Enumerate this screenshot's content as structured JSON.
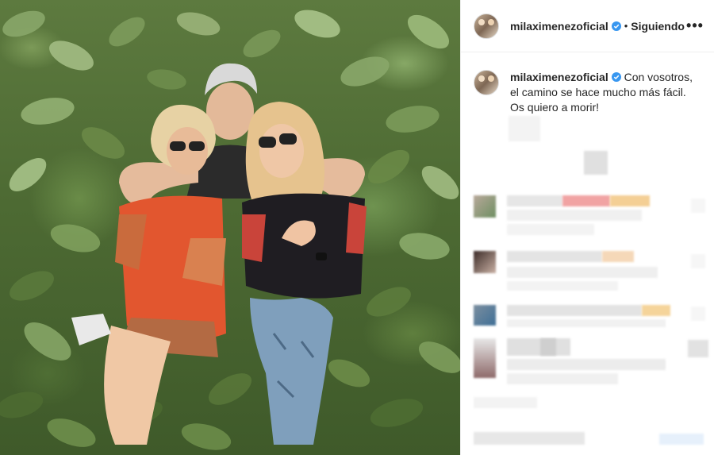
{
  "post": {
    "username": "milaximenezoficial",
    "follow_status": "Siguiendo",
    "separator": "•",
    "more_symbol": "•••",
    "caption": "Con vosotros, el camino se hace mucho más fácil. Os quiero a morir!"
  },
  "colors": {
    "verified": "#3897f0",
    "text": "#262626",
    "border": "#efefef"
  },
  "icons": {
    "verified": "verified-badge-icon",
    "more": "more-options-icon"
  }
}
